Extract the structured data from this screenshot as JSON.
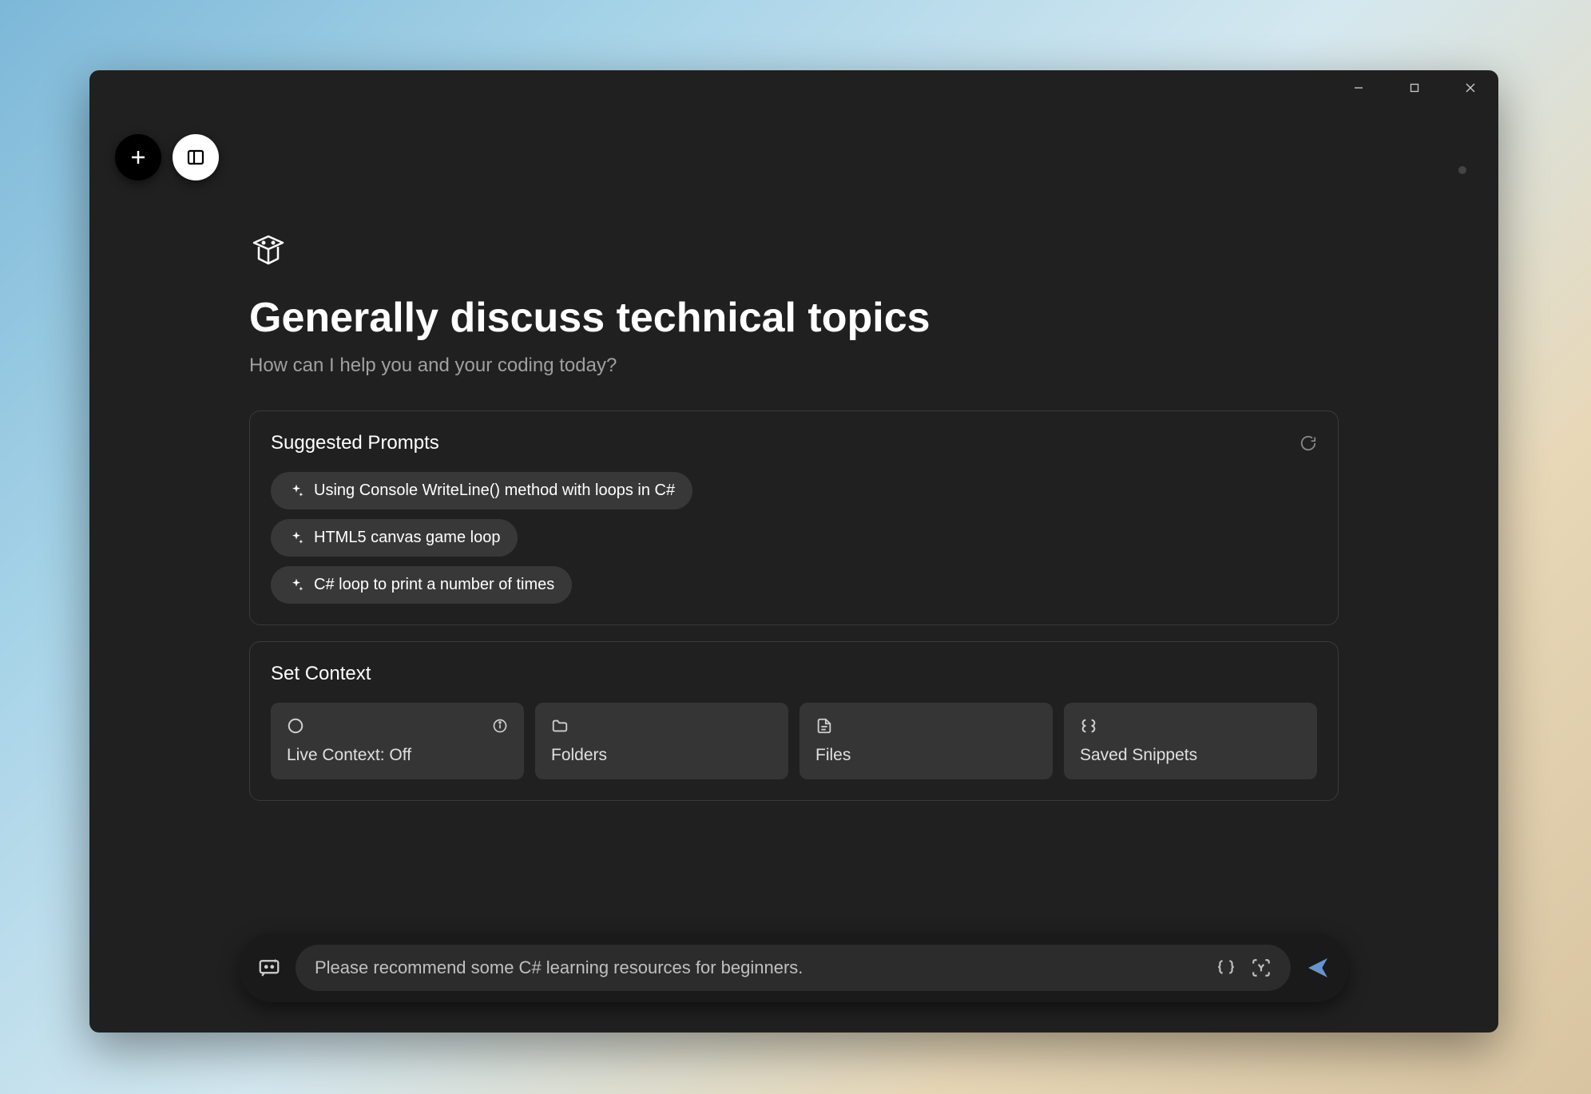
{
  "heading": "Generally discuss technical topics",
  "subheading": "How can I help you and your coding today?",
  "suggested": {
    "title": "Suggested Prompts",
    "items": [
      "Using Console WriteLine() method with loops in C#",
      "HTML5 canvas game loop",
      "C# loop to print a number of times"
    ]
  },
  "context": {
    "title": "Set Context",
    "items": [
      {
        "label": "Live Context: Off"
      },
      {
        "label": "Folders"
      },
      {
        "label": "Files"
      },
      {
        "label": "Saved Snippets"
      }
    ]
  },
  "input": {
    "value": "Please recommend some C# learning resources for beginners."
  }
}
